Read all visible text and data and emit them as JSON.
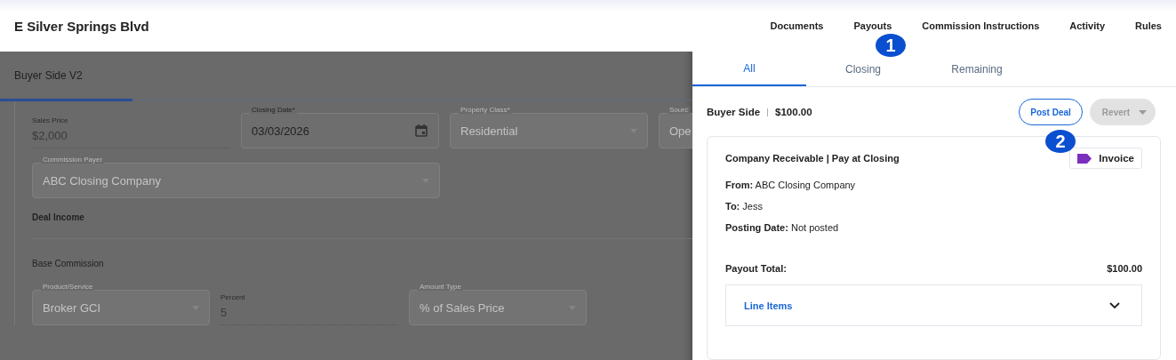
{
  "header": {
    "title": "E Silver Springs Blvd",
    "nav": [
      {
        "label": "Documents"
      },
      {
        "label": "Payouts"
      },
      {
        "label": "Commission Instructions"
      },
      {
        "label": "Activity"
      },
      {
        "label": "Rules"
      }
    ]
  },
  "form": {
    "tab": {
      "label": "Buyer Side  V2",
      "selected": true
    },
    "rows": [
      [
        {
          "kind": "text",
          "label": "Sales Price",
          "value": "$2,000"
        },
        {
          "kind": "date",
          "label": "Closing Date*",
          "value": "03/03/2026",
          "disabled": false
        },
        {
          "kind": "select",
          "label": "Property Class*",
          "value": "Residential",
          "disabled": true
        },
        {
          "kind": "select",
          "label": "Sourc",
          "value": "Ope",
          "disabled": true
        }
      ],
      [
        {
          "kind": "select",
          "label": "Commission Payer",
          "value": "ABC Closing Company",
          "disabled": true
        }
      ]
    ],
    "section": "Deal Income",
    "subsection": "Base Commission",
    "commission_row": [
      {
        "kind": "select",
        "label": "Product/Service",
        "value": "Broker GCI",
        "disabled": true
      },
      {
        "kind": "text",
        "label": "Percent",
        "value": "5"
      },
      {
        "kind": "select",
        "label": "Amount Type",
        "value": "% of Sales Price",
        "disabled": true
      }
    ]
  },
  "drawer": {
    "tabs": [
      {
        "label": "All",
        "selected": true
      },
      {
        "label": "Closing",
        "selected": false
      },
      {
        "label": "Remaining",
        "selected": false
      }
    ],
    "summary": {
      "side": "Buyer Side",
      "amount": "$100.00"
    },
    "buttons": [
      {
        "kind": "plain",
        "label": "Post Deal",
        "disabled": false
      },
      {
        "kind": "split",
        "label": "Revert",
        "disabled": true
      }
    ],
    "payout": {
      "title": "Company Receivable | Pay at Closing",
      "tag": {
        "label": "Invoice",
        "color": "#7b2fbe"
      },
      "details": [
        {
          "label": "From:",
          "value": "ABC Closing Company"
        },
        {
          "label": "To:",
          "value": "Jess"
        },
        {
          "label": "Posting Date:",
          "value": "Not posted"
        }
      ],
      "total_label": "Payout Total:",
      "total": "$100.00",
      "line_items": {
        "label": "Line Items",
        "expanded": false
      }
    }
  },
  "annotations": [
    {
      "label": "1"
    },
    {
      "label": "2"
    }
  ]
}
